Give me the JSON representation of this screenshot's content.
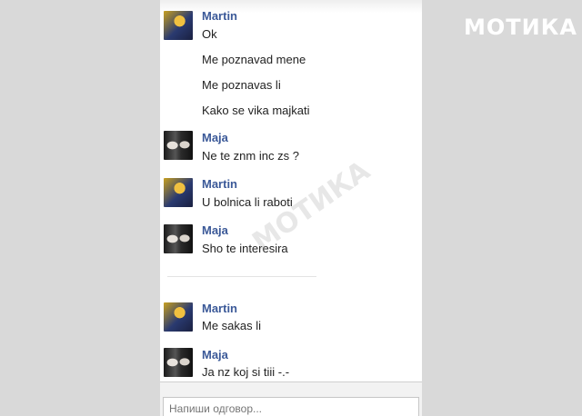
{
  "watermark": {
    "text": "МОТИКА"
  },
  "chat": {
    "groups": [
      {
        "sender": "Martin",
        "lines": [
          "Ok",
          "Me poznavad mene",
          "Me poznavas li",
          "Kako se vika majkati"
        ]
      },
      {
        "sender": "Maja",
        "lines": [
          "Ne te znm inc zs ?"
        ]
      },
      {
        "sender": "Martin",
        "lines": [
          "U bolnica li raboti"
        ]
      },
      {
        "sender": "Maja",
        "lines": [
          "Sho te interesira"
        ]
      },
      {
        "sender": "Martin",
        "lines": [
          "Me sakas li"
        ]
      },
      {
        "sender": "Maja",
        "lines": [
          "Ja nz koj si tiii -.-"
        ]
      }
    ]
  },
  "composer": {
    "placeholder": "Напиши одговор..."
  },
  "colors": {
    "name": "#3b5998",
    "text": "#222222",
    "background": "#d9d9d9"
  }
}
